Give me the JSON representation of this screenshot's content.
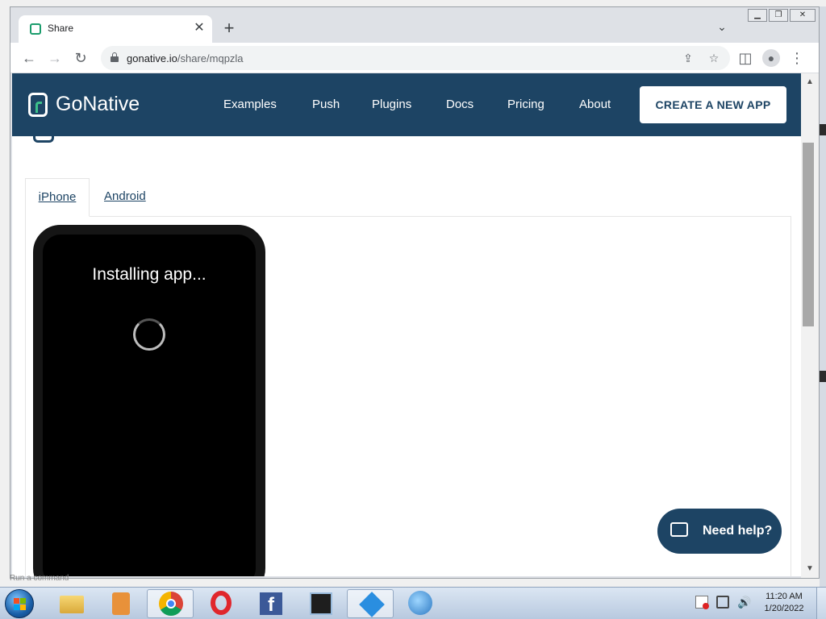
{
  "browser": {
    "tab_title": "Share",
    "tab_close": "✕",
    "new_tab": "+",
    "url_host": "gonative.io",
    "url_path": "/share/mqpzla",
    "icons": [
      "back-icon",
      "forward-icon",
      "reload-icon",
      "lock-icon",
      "share-icon",
      "star-icon",
      "sidebar-icon",
      "profile-icon",
      "menu-icon"
    ]
  },
  "site": {
    "logo_text": "GoNative",
    "nav": [
      "Examples",
      "Push",
      "Plugins",
      "Docs",
      "Pricing",
      "About"
    ],
    "cta": "CREATE A NEW APP",
    "brand_color": "#1d4464",
    "accent_color": "#3cc08a"
  },
  "platform_tabs": {
    "iphone": "iPhone",
    "android": "Android",
    "selected": "iPhone"
  },
  "phone": {
    "status": "Installing app..."
  },
  "help": {
    "label": "Need help?"
  },
  "status_strip": "Run a command",
  "taskbar": {
    "apps": [
      "explorer",
      "media-player",
      "chrome",
      "opera",
      "facebook",
      "app-6",
      "app-7",
      "app-8"
    ],
    "active_app": "chrome",
    "clock_time": "11:20 AM",
    "clock_date": "1/20/2022"
  }
}
